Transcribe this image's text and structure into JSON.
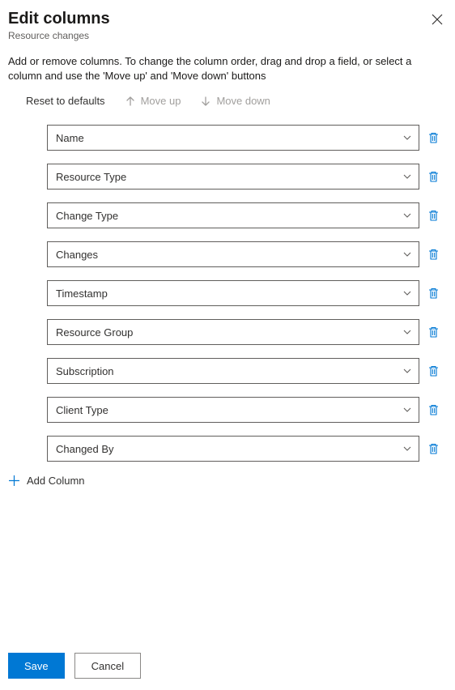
{
  "header": {
    "title": "Edit columns",
    "subtitle": "Resource changes",
    "description": "Add or remove columns. To change the column order, drag and drop a field, or select a column and use the 'Move up' and 'Move down' buttons"
  },
  "toolbar": {
    "resetLabel": "Reset to defaults",
    "moveUpLabel": "Move up",
    "moveDownLabel": "Move down"
  },
  "columns": [
    {
      "label": "Name"
    },
    {
      "label": "Resource Type"
    },
    {
      "label": "Change Type"
    },
    {
      "label": "Changes"
    },
    {
      "label": "Timestamp"
    },
    {
      "label": "Resource Group"
    },
    {
      "label": "Subscription"
    },
    {
      "label": "Client Type"
    },
    {
      "label": "Changed By"
    }
  ],
  "addColumnLabel": "Add Column",
  "footer": {
    "saveLabel": "Save",
    "cancelLabel": "Cancel"
  },
  "colors": {
    "primary": "#0078d4",
    "border": "#605e5c",
    "disabled": "#a19f9d"
  }
}
